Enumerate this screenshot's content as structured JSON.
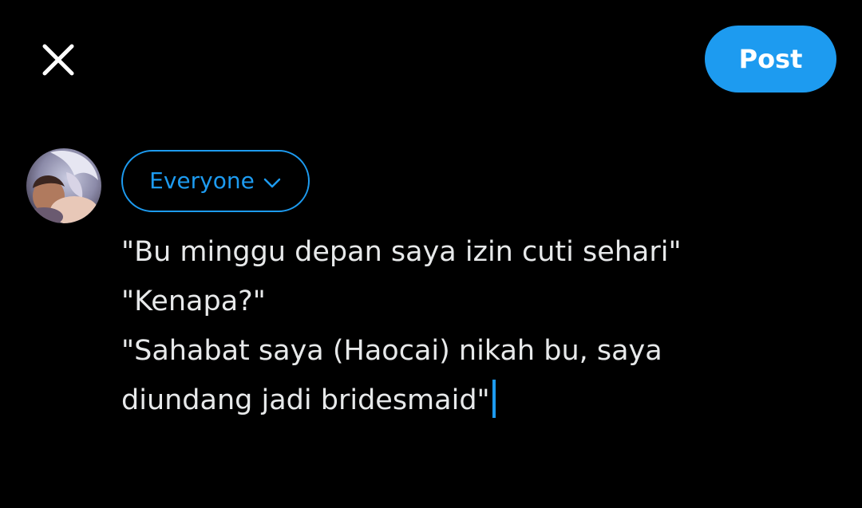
{
  "header": {
    "close_icon": "close-icon",
    "post_label": "Post"
  },
  "composer": {
    "avatar_icon": "user-avatar",
    "audience_label": "Everyone",
    "audience_icon": "chevron-down-icon",
    "lines": [
      "\"Bu minggu depan saya izin cuti sehari\"",
      "\"Kenapa?\"",
      "\"Sahabat saya (Haocai) nikah bu, saya",
      "diundang jadi bridesmaid\""
    ]
  },
  "colors": {
    "background": "#000000",
    "accent": "#1d9bf0",
    "text": "#e7e9ea"
  }
}
